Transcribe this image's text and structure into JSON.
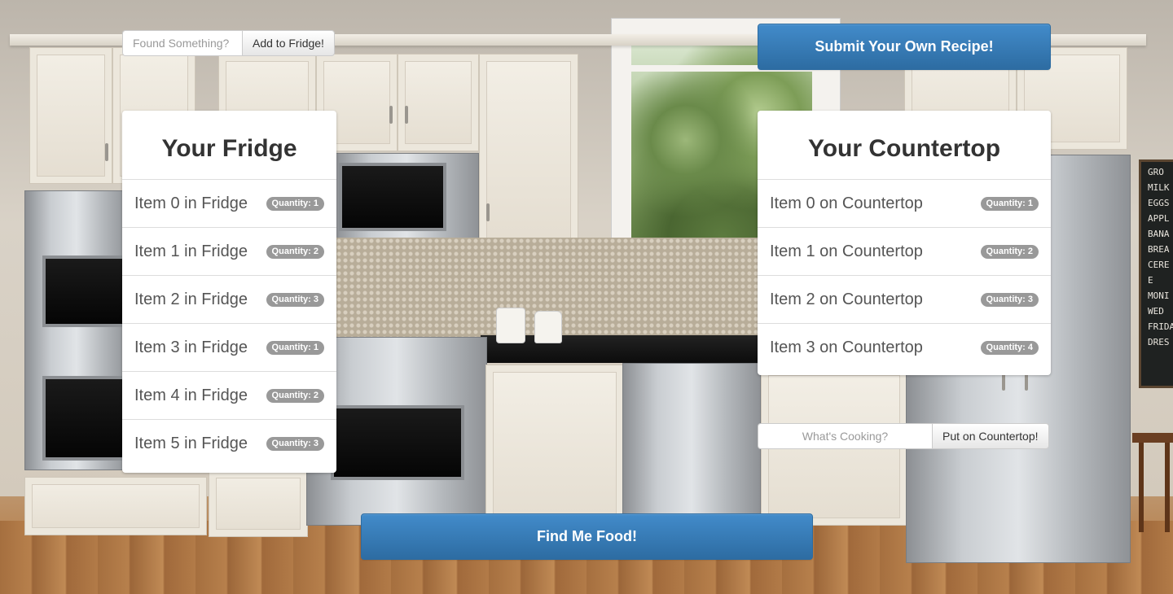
{
  "fridge_input": {
    "placeholder": "Found Something?",
    "button_label": "Add to Fridge!"
  },
  "submit_recipe_label": "Submit Your Own Recipe!",
  "fridge": {
    "title": "Your Fridge",
    "items": [
      {
        "name": "Item 0 in Fridge",
        "quantity": "Quantity: 1"
      },
      {
        "name": "Item 1 in Fridge",
        "quantity": "Quantity: 2"
      },
      {
        "name": "Item 2 in Fridge",
        "quantity": "Quantity: 3"
      },
      {
        "name": "Item 3 in Fridge",
        "quantity": "Quantity: 1"
      },
      {
        "name": "Item 4 in Fridge",
        "quantity": "Quantity: 2"
      },
      {
        "name": "Item 5 in Fridge",
        "quantity": "Quantity: 3"
      }
    ]
  },
  "countertop": {
    "title": "Your Countertop",
    "items": [
      {
        "name": "Item 0 on Countertop",
        "quantity": "Quantity: 1"
      },
      {
        "name": "Item 1 on Countertop",
        "quantity": "Quantity: 2"
      },
      {
        "name": "Item 2 on Countertop",
        "quantity": "Quantity: 3"
      },
      {
        "name": "Item 3 on Countertop",
        "quantity": "Quantity: 4"
      }
    ]
  },
  "countertop_input": {
    "placeholder": "What's Cooking?",
    "button_label": "Put on Countertop!"
  },
  "find_food_label": "Find Me Food!",
  "chalkboard_lines": [
    "GRO",
    "MILK",
    "EGGS",
    "APPL",
    "BANA",
    "BREA",
    "CERE",
    "",
    "E",
    "",
    "MONI",
    "",
    "WED",
    "",
    "FRIDA",
    "DRES"
  ],
  "colors": {
    "primary": "#428bca",
    "badge": "#999999"
  }
}
